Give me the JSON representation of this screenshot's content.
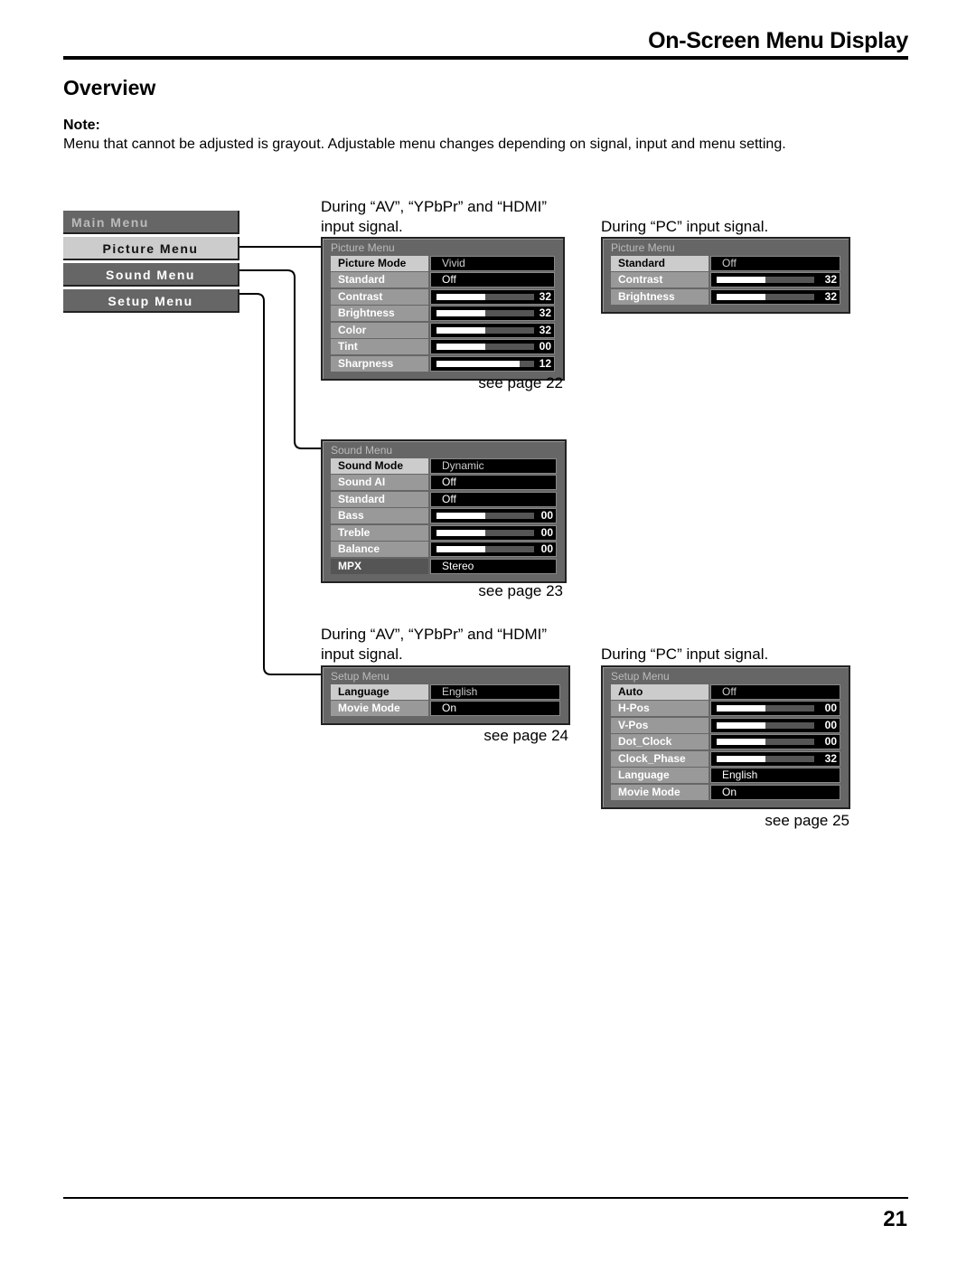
{
  "header": {
    "title": "On-Screen Menu Display"
  },
  "section_title": "Overview",
  "note": {
    "label": "Note:",
    "text": "Menu that cannot be adjusted is grayout. Adjustable menu changes depending on signal, input and menu setting."
  },
  "main_menu": {
    "title": "Main Menu",
    "items": [
      {
        "label": "Picture Menu",
        "selected": true
      },
      {
        "label": "Sound Menu",
        "selected": false
      },
      {
        "label": "Setup Menu",
        "selected": false
      }
    ]
  },
  "captions": {
    "av_line1": "During “AV”, “YPbPr” and “HDMI”",
    "av_line2": "input signal.",
    "pc": "During “PC” input signal.",
    "av2_line1": "During “AV”, “YPbPr” and “HDMI”",
    "av2_line2": "input signal.",
    "pc2": "During “PC” input signal."
  },
  "panels": {
    "picture_av": {
      "title": "Picture Menu",
      "see_page": "see page 22",
      "rows": [
        {
          "label": "Picture Mode",
          "type": "text",
          "value": "Vivid",
          "style": "sel"
        },
        {
          "label": "Standard",
          "type": "text",
          "value": "Off"
        },
        {
          "label": "Contrast",
          "type": "bar",
          "value": "32",
          "level": 0.5
        },
        {
          "label": "Brightness",
          "type": "bar",
          "value": "32",
          "level": 0.5
        },
        {
          "label": "Color",
          "type": "bar",
          "value": "32",
          "level": 0.5
        },
        {
          "label": "Tint",
          "type": "bar",
          "value": "00",
          "level": 0.5
        },
        {
          "label": "Sharpness",
          "type": "bar",
          "value": "12",
          "level": 0.85
        }
      ]
    },
    "picture_pc": {
      "title": "Picture Menu",
      "rows": [
        {
          "label": "Standard",
          "type": "text",
          "value": "Off",
          "style": "sel"
        },
        {
          "label": "Contrast",
          "type": "bar",
          "value": "32",
          "level": 0.5
        },
        {
          "label": "Brightness",
          "type": "bar",
          "value": "32",
          "level": 0.5
        }
      ]
    },
    "sound": {
      "title": "Sound Menu",
      "see_page": "see page 23",
      "rows": [
        {
          "label": "Sound Mode",
          "type": "text",
          "value": "Dynamic",
          "style": "sel"
        },
        {
          "label": "Sound AI",
          "type": "text",
          "value": "Off"
        },
        {
          "label": "Standard",
          "type": "text",
          "value": "Off"
        },
        {
          "label": "Bass",
          "type": "bar",
          "value": "00",
          "level": 0.5
        },
        {
          "label": "Treble",
          "type": "bar",
          "value": "00",
          "level": 0.5
        },
        {
          "label": "Balance",
          "type": "bar",
          "value": "00",
          "level": 0.5
        },
        {
          "label": "MPX",
          "type": "text",
          "value": "Stereo",
          "style": "dark"
        }
      ]
    },
    "setup_av": {
      "title": "Setup Menu",
      "see_page": "see page 24",
      "rows": [
        {
          "label": "Language",
          "type": "text",
          "value": "English",
          "style": "sel"
        },
        {
          "label": "Movie Mode",
          "type": "text",
          "value": "On"
        }
      ]
    },
    "setup_pc": {
      "title": "Setup Menu",
      "see_page": "see page 25",
      "rows": [
        {
          "label": "Auto",
          "type": "text",
          "value": "Off",
          "style": "sel"
        },
        {
          "label": "H-Pos",
          "type": "bar",
          "value": "00",
          "level": 0.5
        },
        {
          "label": "V-Pos",
          "type": "bar",
          "value": "00",
          "level": 0.5
        },
        {
          "label": "Dot_Clock",
          "type": "bar",
          "value": "00",
          "level": 0.5
        },
        {
          "label": "Clock_Phase",
          "type": "bar",
          "value": "32",
          "level": 0.5
        },
        {
          "label": "Language",
          "type": "text",
          "value": "English"
        },
        {
          "label": "Movie Mode",
          "type": "text",
          "value": "On"
        }
      ]
    }
  },
  "page_number": "21"
}
